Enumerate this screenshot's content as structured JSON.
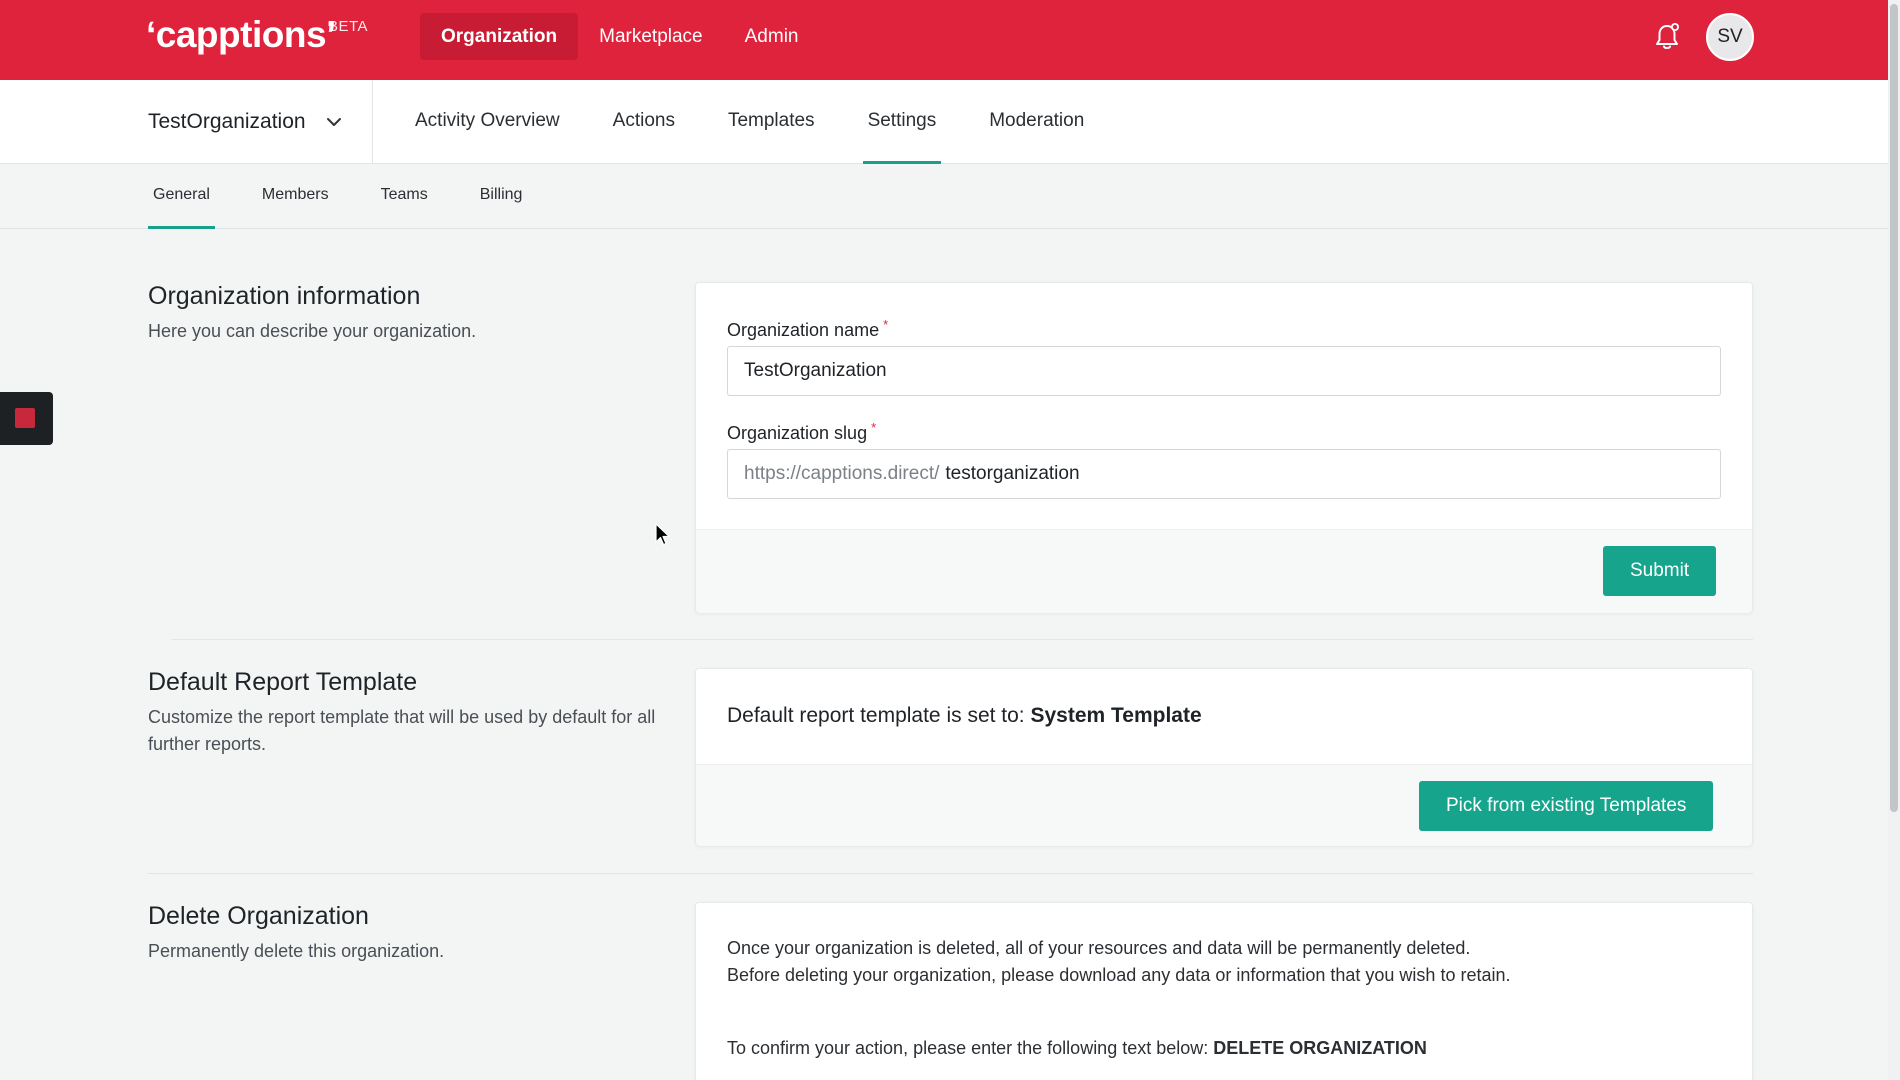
{
  "brand": {
    "logo": "‘capptions’",
    "badge": "BETA",
    "color": "#e0233d",
    "accent": "#16a48d"
  },
  "topnav": {
    "items": [
      {
        "label": "Organization",
        "active": true
      },
      {
        "label": "Marketplace",
        "active": false
      },
      {
        "label": "Admin",
        "active": false
      }
    ],
    "bell_icon": "bell-icon",
    "avatar_initials": "SV"
  },
  "subnav": {
    "org_name": "TestOrganization",
    "items": [
      {
        "label": "Activity Overview"
      },
      {
        "label": "Actions"
      },
      {
        "label": "Templates"
      },
      {
        "label": "Settings",
        "active": true
      },
      {
        "label": "Moderation"
      }
    ]
  },
  "tabs": [
    {
      "label": "General",
      "active": true
    },
    {
      "label": "Members"
    },
    {
      "label": "Teams"
    },
    {
      "label": "Billing"
    }
  ],
  "org_info": {
    "title": "Organization information",
    "description": "Here you can describe your organization.",
    "name_label": "Organization name",
    "name_value": "TestOrganization",
    "slug_label": "Organization slug",
    "slug_prefix": "https://capptions.direct/",
    "slug_value": "testorganization",
    "required_mark": "*",
    "submit_label": "Submit"
  },
  "default_template": {
    "title": "Default Report Template",
    "description": "Customize the report template that will be used by default for all further reports.",
    "status_prefix": "Default report template is set to: ",
    "status_value": "System Template",
    "pick_label": "Pick from existing Templates"
  },
  "delete_org": {
    "title": "Delete Organization",
    "description": "Permanently delete this organization.",
    "warning": "Once your organization is deleted, all of your resources and data will be permanently deleted. Before deleting your organization, please download any data or information that you wish to retain.",
    "confirm_prefix": "To confirm your action, please enter the following text below: ",
    "confirm_text": "DELETE ORGANIZATION"
  }
}
